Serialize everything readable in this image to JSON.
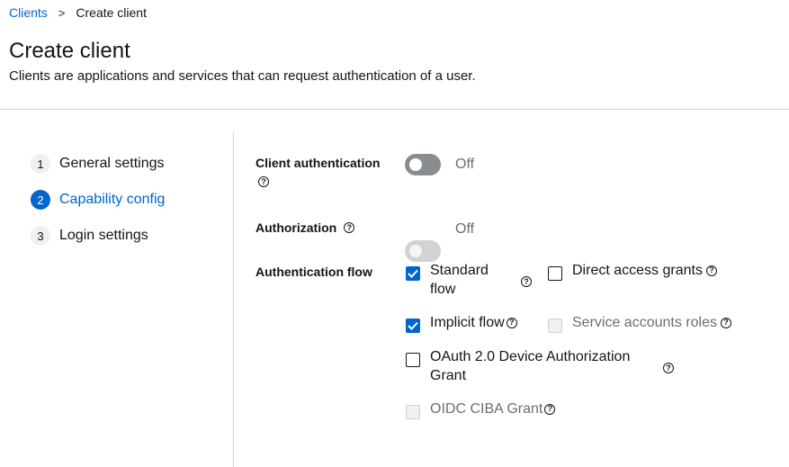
{
  "breadcrumb": {
    "parent": "Clients",
    "separator": "›",
    "current": "Create client"
  },
  "header": {
    "title": "Create client",
    "description": "Clients are applications and services that can request authentication of a user."
  },
  "wizard": {
    "steps": [
      {
        "number": "1",
        "label": "General settings",
        "current": false
      },
      {
        "number": "2",
        "label": "Capability config",
        "current": true
      },
      {
        "number": "3",
        "label": "Login settings",
        "current": false
      }
    ]
  },
  "form": {
    "client_authentication": {
      "label": "Client authentication",
      "state_text": "Off",
      "enabled": false
    },
    "authorization": {
      "label": "Authorization",
      "state_text": "Off",
      "enabled": false,
      "disabled": true
    },
    "authentication_flow": {
      "label": "Authentication flow",
      "options": [
        {
          "label": "Standard flow",
          "line1": "Standard",
          "line2": "flow",
          "checked": true,
          "disabled": false
        },
        {
          "label": "Direct access grants",
          "checked": false,
          "disabled": false
        },
        {
          "label": "Implicit flow",
          "checked": true,
          "disabled": false
        },
        {
          "label": "Service accounts roles",
          "checked": false,
          "disabled": true
        },
        {
          "label": "OAuth 2.0 Device Authorization Grant",
          "line1": "OAuth 2.0 Device Authorization",
          "line2": "Grant",
          "checked": false,
          "disabled": false
        },
        {
          "label": "OIDC CIBA Grant",
          "checked": false,
          "disabled": true
        }
      ]
    },
    "help_glyph": "?"
  },
  "colors": {
    "accent": "#0066cc",
    "switch_off": "#8a8d90",
    "divider": "#d2d2d2"
  },
  "icons": {
    "breadcrumb_separator": "chevron-right-icon",
    "help": "help-circle-icon",
    "check": "check-icon"
  }
}
